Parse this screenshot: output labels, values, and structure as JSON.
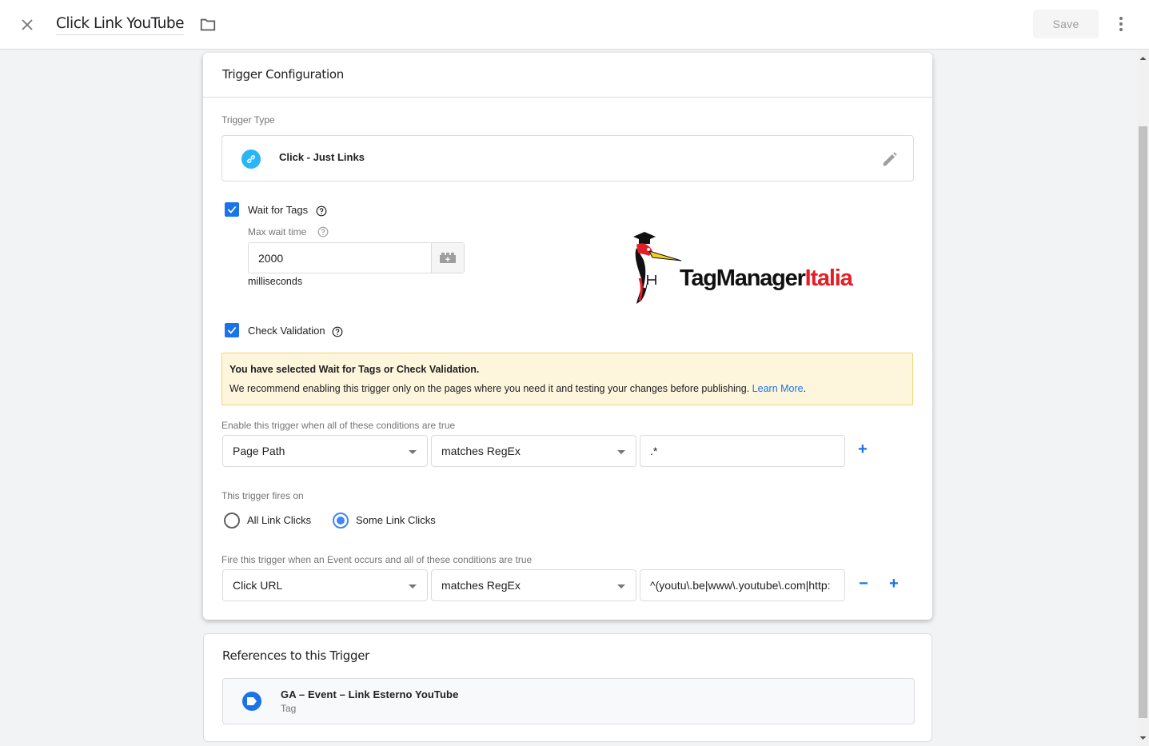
{
  "header": {
    "title": "Click Link YouTube",
    "save_label": "Save",
    "icons": {
      "close": "close-icon",
      "folder": "folder-icon",
      "more": "more-vert-icon"
    }
  },
  "trigger_config": {
    "title": "Trigger Configuration",
    "trigger_type_label": "Trigger Type",
    "trigger_type_name": "Click - Just Links",
    "trigger_type_icon": "link-icon",
    "wait_for_tags": {
      "label": "Wait for Tags",
      "checked": true,
      "max_wait_label": "Max wait time",
      "max_wait_value": "2000",
      "unit": "milliseconds"
    },
    "check_validation": {
      "label": "Check Validation",
      "checked": true
    },
    "logo": {
      "text_black": "TagManager",
      "text_red": "Italia"
    },
    "warning": {
      "title": "You have selected Wait for Tags or Check Validation.",
      "body": "We recommend enabling this trigger only on the pages where you need it and testing your changes before publishing.",
      "link": "Learn More",
      "link_suffix": "."
    },
    "enable_conditions": {
      "label": "Enable this trigger when all of these conditions are true",
      "variable": "Page Path",
      "operator": "matches RegEx",
      "value": ".*",
      "add_label": "+"
    },
    "fires_on": {
      "label": "This trigger fires on",
      "options": [
        "All Link Clicks",
        "Some Link Clicks"
      ],
      "selected": "Some Link Clicks"
    },
    "fire_conditions": {
      "label": "Fire this trigger when an Event occurs and all of these conditions are true",
      "variable": "Click URL",
      "operator": "matches RegEx",
      "value": "^(youtu\\.be|www\\.youtube\\.com|http:",
      "remove_label": "−",
      "add_label": "+"
    }
  },
  "references": {
    "title": "References to this Trigger",
    "items": [
      {
        "name": "GA – Event – Link Esterno YouTube",
        "type": "Tag"
      }
    ]
  },
  "colors": {
    "accent": "#1a73e8",
    "trigger_icon": "#29b6f6",
    "warning_bg": "#fdf6dd",
    "warning_border": "#f6d26b",
    "logo_red": "#e41e26"
  }
}
